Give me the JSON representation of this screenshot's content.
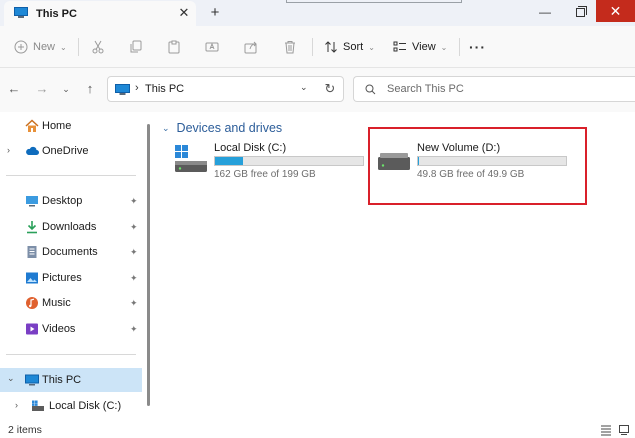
{
  "window": {
    "tab_title": "This PC",
    "close_tab_glyph": "✕",
    "new_tab_glyph": "+",
    "minimize_glyph": "—",
    "close_glyph": "✕"
  },
  "toolbar": {
    "new_label": "New",
    "sort_label": "Sort",
    "view_label": "View",
    "more_glyph": "···"
  },
  "address": {
    "path": "This PC",
    "separator": "›",
    "search_placeholder": "Search This PC"
  },
  "sidebar": {
    "items": [
      {
        "label": "Home",
        "icon": "home-icon"
      },
      {
        "label": "OneDrive",
        "icon": "cloud-icon"
      },
      {
        "label": "Desktop",
        "icon": "desktop-icon"
      },
      {
        "label": "Downloads",
        "icon": "download-icon"
      },
      {
        "label": "Documents",
        "icon": "document-icon"
      },
      {
        "label": "Pictures",
        "icon": "pictures-icon"
      },
      {
        "label": "Music",
        "icon": "music-icon"
      },
      {
        "label": "Videos",
        "icon": "videos-icon"
      },
      {
        "label": "This PC",
        "icon": "computer-icon"
      },
      {
        "label": "Local Disk (C:)",
        "icon": "drive-icon"
      }
    ],
    "pin_glyph": "📌"
  },
  "main": {
    "group_title": "Devices and drives",
    "drives": [
      {
        "name": "Local Disk (C:)",
        "free_text": "162 GB free of 199 GB",
        "used_fraction": 0.186
      },
      {
        "name": "New Volume (D:)",
        "free_text": "49.8 GB free of 49.9 GB",
        "used_fraction": 0.002
      }
    ]
  },
  "status": {
    "item_count": "2 items"
  },
  "colors": {
    "accent": "#26a0da",
    "selection": "#cce4f7",
    "close_red": "#c42b1c",
    "highlight_red": "#d9202a",
    "group_title": "#2c5d99"
  }
}
